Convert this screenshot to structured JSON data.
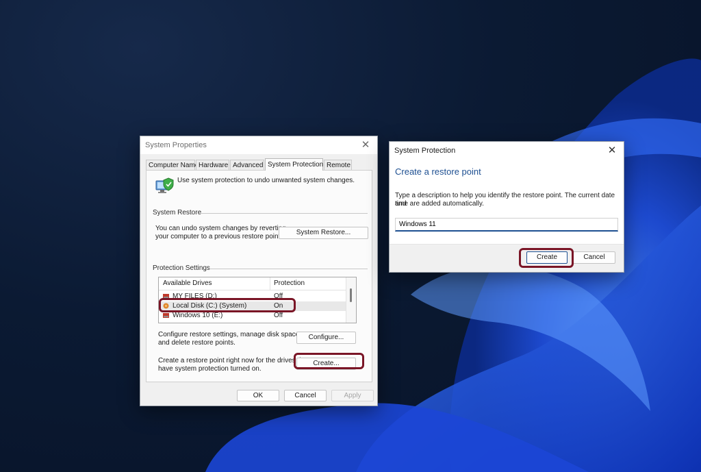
{
  "system_properties": {
    "title": "System Properties",
    "tabs": [
      {
        "label": "Computer Name",
        "active": false
      },
      {
        "label": "Hardware",
        "active": false
      },
      {
        "label": "Advanced",
        "active": false
      },
      {
        "label": "System Protection",
        "active": true
      },
      {
        "label": "Remote",
        "active": false
      }
    ],
    "intro_text": "Use system protection to undo unwanted system changes.",
    "system_restore": {
      "group_label": "System Restore",
      "description_line1": "You can undo system changes by reverting",
      "description_line2": "your computer to a previous restore point.",
      "button_label": "System Restore..."
    },
    "protection_settings": {
      "group_label": "Protection Settings",
      "columns": [
        "Available Drives",
        "Protection"
      ],
      "drives": [
        {
          "name": "MY FILES (D:)",
          "protection": "Off",
          "selected": false
        },
        {
          "name": "Local Disk (C:) (System)",
          "protection": "On",
          "selected": true
        },
        {
          "name": "Windows 10 (E:)",
          "protection": "Off",
          "selected": false
        }
      ],
      "configure_text_line1": "Configure restore settings, manage disk space,",
      "configure_text_line2": "and delete restore points.",
      "configure_button": "Configure...",
      "create_text_line1": "Create a restore point right now for the drives that",
      "create_text_line2": "have system protection turned on.",
      "create_button": "Create..."
    },
    "buttons": {
      "ok": "OK",
      "cancel": "Cancel",
      "apply": "Apply"
    }
  },
  "system_protection_dialog": {
    "title": "System Protection",
    "heading": "Create a restore point",
    "description_line1": "Type a description to help you identify the restore point. The current date and",
    "description_line2": "time are added automatically.",
    "input_value": "Windows 11",
    "create_button": "Create",
    "cancel_button": "Cancel"
  },
  "colors": {
    "highlight": "#7a1526",
    "dialog_heading": "#1d4f91",
    "wallpaper_bloom": "#1f4fe0"
  },
  "icons": {
    "system_protection": "computer-shield-icon",
    "close": "close-icon",
    "drive": "drive-icon"
  }
}
